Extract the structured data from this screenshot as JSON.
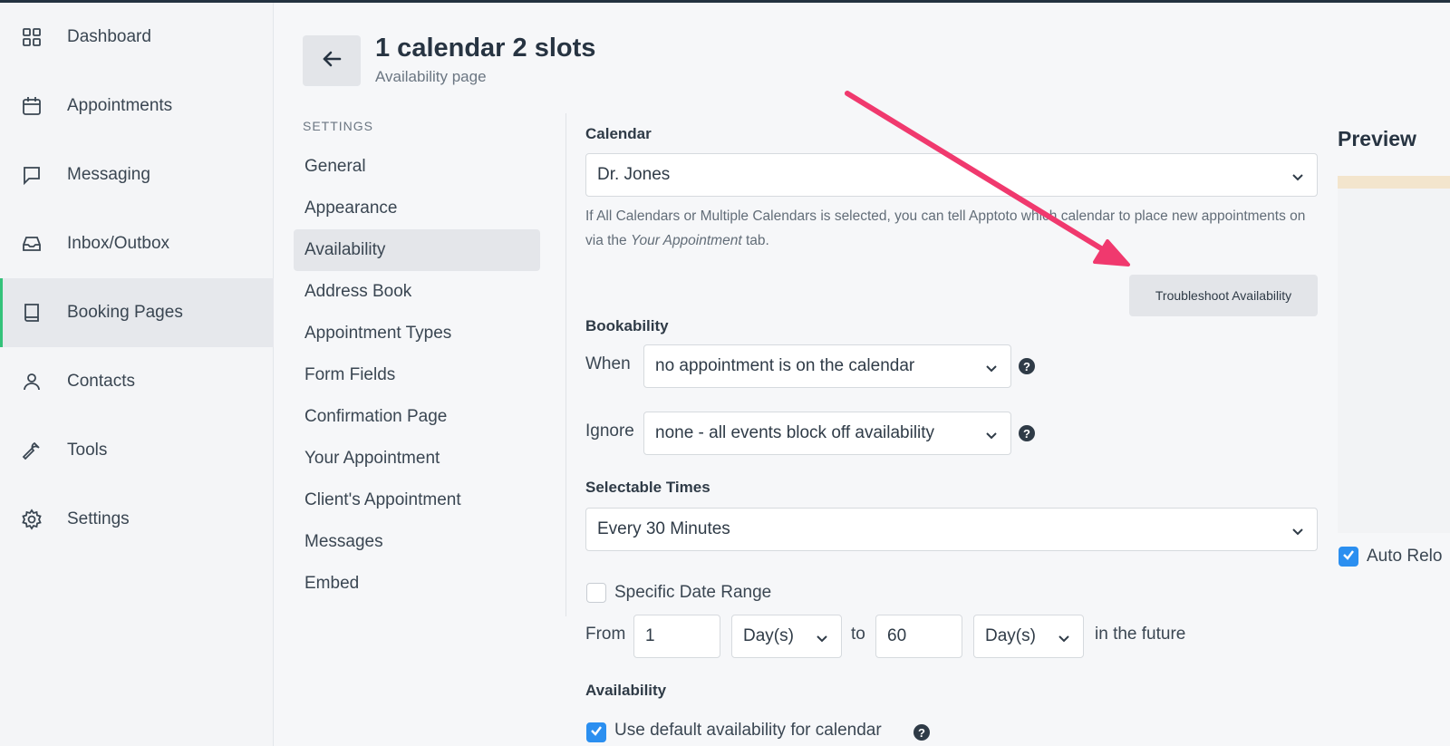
{
  "nav": {
    "items": [
      {
        "label": "Dashboard",
        "icon": "grid-icon"
      },
      {
        "label": "Appointments",
        "icon": "calendar-icon"
      },
      {
        "label": "Messaging",
        "icon": "chat-icon"
      },
      {
        "label": "Inbox/Outbox",
        "icon": "inbox-icon"
      },
      {
        "label": "Booking Pages",
        "icon": "book-icon",
        "active": true
      },
      {
        "label": "Contacts",
        "icon": "person-icon"
      },
      {
        "label": "Tools",
        "icon": "wrench-icon"
      },
      {
        "label": "Settings",
        "icon": "gear-icon"
      }
    ]
  },
  "header": {
    "title": "1 calendar 2 slots",
    "subtitle": "Availability page"
  },
  "settings_nav": {
    "heading": "SETTINGS",
    "items": [
      "General",
      "Appearance",
      "Availability",
      "Address Book",
      "Appointment Types",
      "Form Fields",
      "Confirmation Page",
      "Your Appointment",
      "Client's Appointment",
      "Messages",
      "Embed"
    ],
    "active": "Availability"
  },
  "form": {
    "calendar_label": "Calendar",
    "calendar_value": "Dr. Jones",
    "calendar_help_1": "If All Calendars or Multiple Calendars is selected, you can tell Apptoto which calendar to place new appointments on via the",
    "calendar_help_em": "Your Appointment",
    "calendar_help_2": "tab.",
    "troubleshoot_label": "Troubleshoot Availability",
    "bookability_label": "Bookability",
    "when_label": "When",
    "when_value": "no appointment is on the calendar",
    "ignore_label": "Ignore",
    "ignore_value": "none - all events block off availability",
    "selectable_label": "Selectable Times",
    "selectable_value": "Every 30 Minutes",
    "specific_range_label": "Specific Date Range",
    "from_label": "From",
    "from_value": "1",
    "from_unit": "Day(s)",
    "to_label": "to",
    "to_value": "60",
    "to_unit": "Day(s)",
    "future_label": "in the future",
    "availability_label": "Availability",
    "default_avail_label": "Use default availability for calendar"
  },
  "preview": {
    "title": "Preview",
    "auto_reload_label": "Auto Relo"
  },
  "colors": {
    "accent_green": "#34c27a",
    "checkbox_blue": "#2b8ff0",
    "arrow_pink": "#f0396e"
  }
}
